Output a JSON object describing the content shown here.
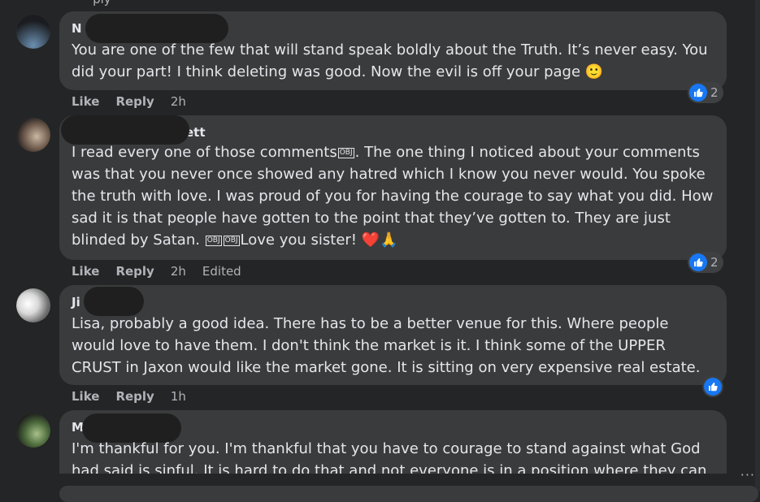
{
  "top_fragment": "··· ply",
  "comments": [
    {
      "author": "N",
      "text": "You are one of the few that will stand speak boldly about the Truth. It’s never easy. You did your part! I think deleting was good. Now the evil is off your page 🙂",
      "actions": {
        "like": "Like",
        "reply": "Reply",
        "time": "2h",
        "edited": ""
      },
      "reaction_count": "2"
    },
    {
      "author": "ett",
      "text_parts": [
        "I read every one of those comments",
        "OBJ",
        ". The one thing I noticed about your comments was that you never once showed any hatred which I know you never would. You spoke the truth with love. I was proud of you for having the courage to say what you did. How sad it is that people have gotten to the point that they’ve gotten to. They are just blinded by Satan. ",
        "OBJ",
        "OBJ",
        "Love you sister! ❤️🙏"
      ],
      "actions": {
        "like": "Like",
        "reply": "Reply",
        "time": "2h",
        "edited": "Edited"
      },
      "reaction_count": "2"
    },
    {
      "author": "Ji",
      "text": "Lisa, probably a good idea. There has to be a better venue for this. Where people would love to have them. I don't think the market is it. I think some of the UPPER CRUST in Jaxon would like the market gone. It is sitting on very expensive real estate.",
      "actions": {
        "like": "Like",
        "reply": "Reply",
        "time": "1h",
        "edited": ""
      },
      "reaction_count": ""
    },
    {
      "author": "M",
      "text": "I'm thankful for you. I'm thankful that you have to courage to stand against what God had said is sinful. It is hard to do that and not everyone is in a position where they can"
    }
  ],
  "more_label": "···",
  "colors": {
    "background": "#242526",
    "bubble": "#3a3b3c",
    "like_blue": "#1877f2",
    "muted": "#b0b3b8"
  }
}
